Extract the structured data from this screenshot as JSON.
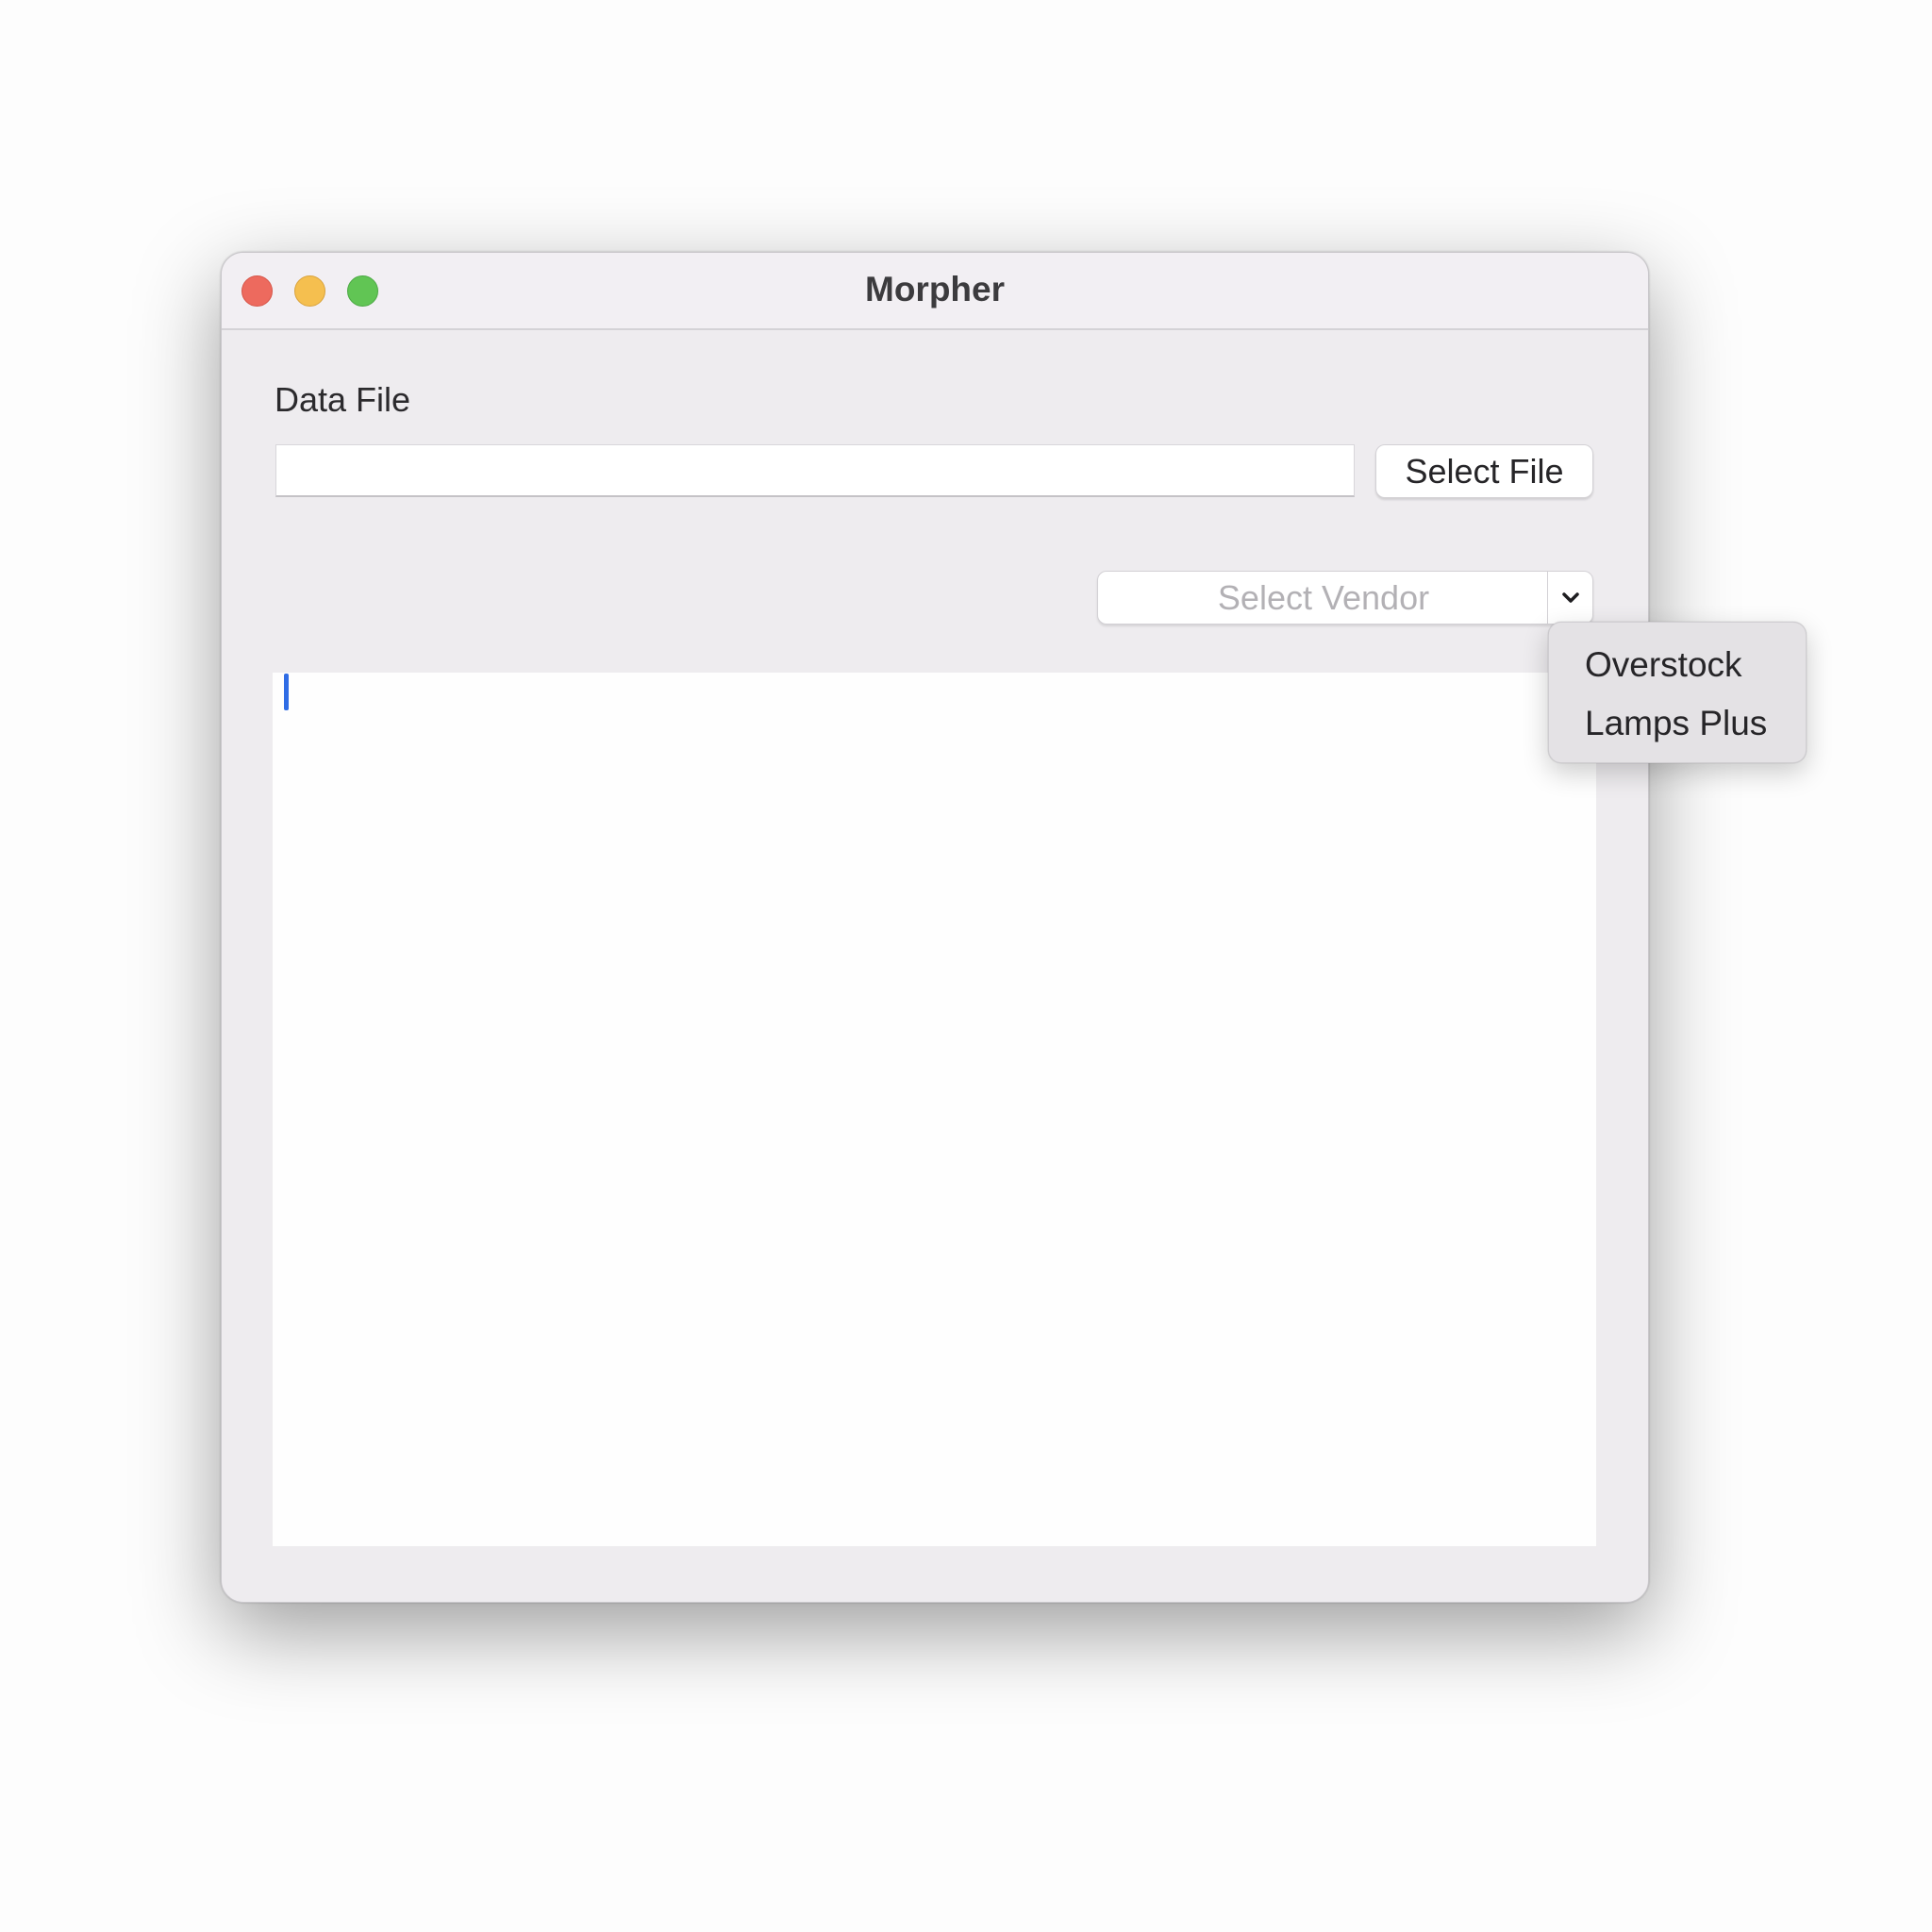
{
  "window": {
    "title": "Morpher"
  },
  "data_file": {
    "label": "Data File",
    "path_value": "",
    "select_button_label": "Select File"
  },
  "vendor": {
    "placeholder": "Select Vendor",
    "options": [
      "Overstock",
      "Lamps Plus"
    ]
  },
  "colors": {
    "close": "#ed6a5e",
    "minimize": "#f5bf4f",
    "zoom": "#61c554",
    "caret": "#2f6ce5"
  },
  "icons": {
    "dropdown": "chevron-down-icon"
  }
}
